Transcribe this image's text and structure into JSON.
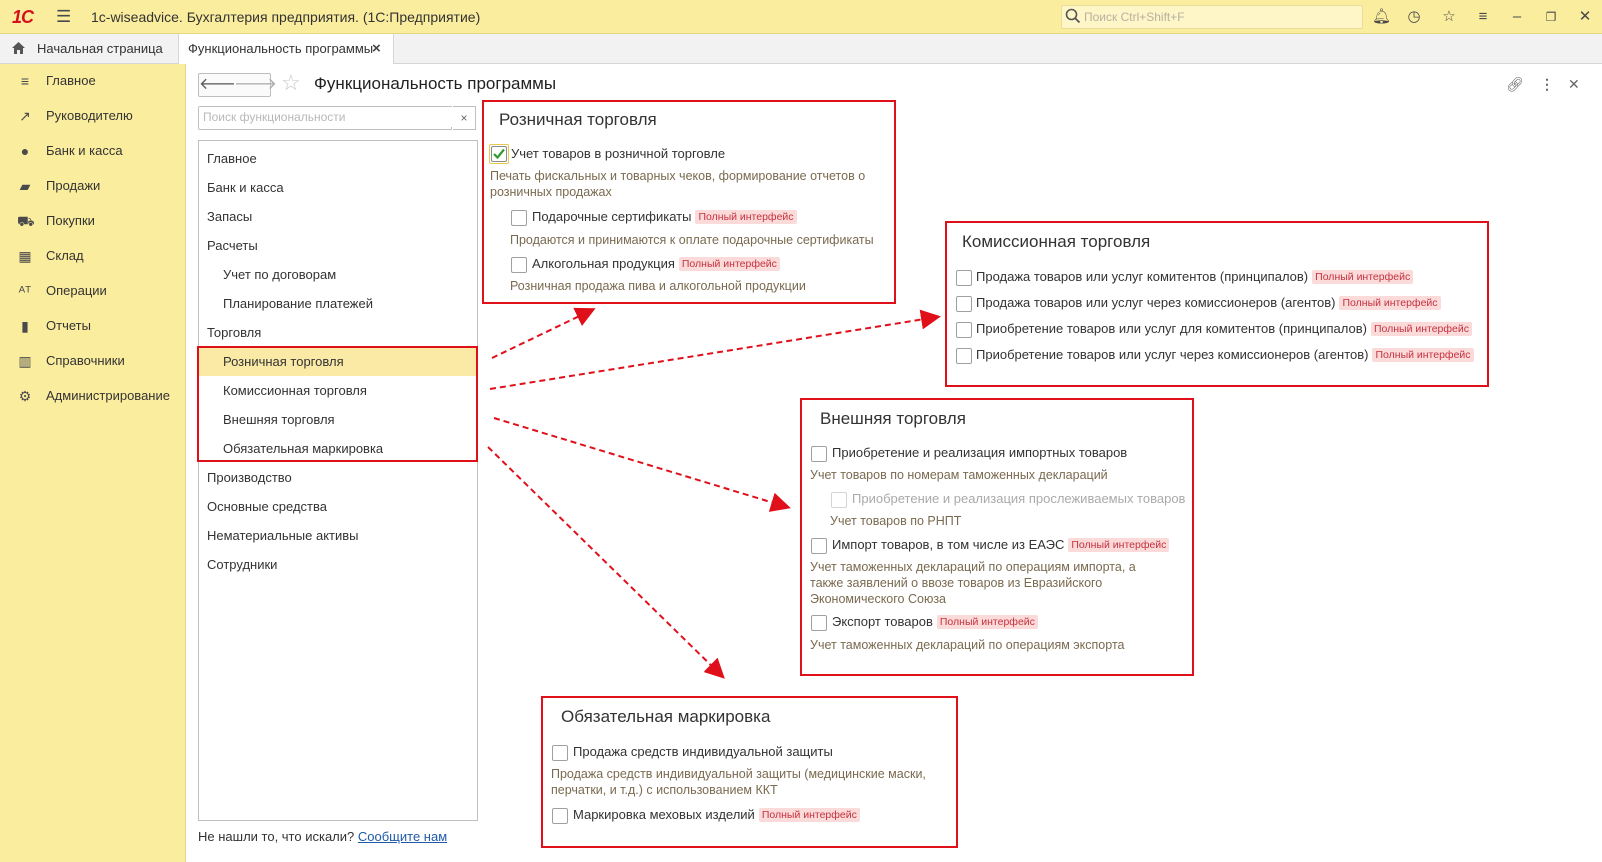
{
  "titlebar": {
    "logo": "1С",
    "title": "1c-wiseadvice. Бухгалтерия предприятия.  (1С:Предприятие)",
    "search_placeholder": "Поиск Ctrl+Shift+F"
  },
  "tabs": {
    "home": "Начальная страница",
    "active": "Функциональность программы",
    "close": "×"
  },
  "sidebar": {
    "items": [
      {
        "label": "Главное",
        "icon": "menu-lines-icon"
      },
      {
        "label": "Руководителю",
        "icon": "trend-icon"
      },
      {
        "label": "Банк и касса",
        "icon": "coin-icon"
      },
      {
        "label": "Продажи",
        "icon": "bag-icon"
      },
      {
        "label": "Покупки",
        "icon": "cart-icon"
      },
      {
        "label": "Склад",
        "icon": "warehouse-icon"
      },
      {
        "label": "Операции",
        "icon": "operations-icon"
      },
      {
        "label": "Отчеты",
        "icon": "bar-chart-icon"
      },
      {
        "label": "Справочники",
        "icon": "book-icon"
      },
      {
        "label": "Администрирование",
        "icon": "gear-icon"
      }
    ]
  },
  "page": {
    "title": "Функциональность программы",
    "func_search_placeholder": "Поиск функциональности",
    "clear": "×",
    "not_found_text": "Не нашли то, что искали?",
    "feedback_link": "Сообщите нам"
  },
  "tree": {
    "items": [
      {
        "label": "Главное",
        "level": 0
      },
      {
        "label": "Банк и касса",
        "level": 0
      },
      {
        "label": "Запасы",
        "level": 0
      },
      {
        "label": "Расчеты",
        "level": 0
      },
      {
        "label": "Учет по договорам",
        "level": 1
      },
      {
        "label": "Планирование платежей",
        "level": 1
      },
      {
        "label": "Торговля",
        "level": 0
      },
      {
        "label": "Розничная торговля",
        "level": 1
      },
      {
        "label": "Комиссионная торговля",
        "level": 1
      },
      {
        "label": "Внешняя торговля",
        "level": 1
      },
      {
        "label": "Обязательная маркировка",
        "level": 1
      },
      {
        "label": "Производство",
        "level": 0
      },
      {
        "label": "Основные средства",
        "level": 0
      },
      {
        "label": "Нематериальные активы",
        "level": 0
      },
      {
        "label": "Сотрудники",
        "level": 0
      }
    ],
    "selected": "Розничная торговля"
  },
  "badge_text": "Полный интерфейс",
  "retail": {
    "title": "Розничная торговля",
    "opt1": "Учет товаров в розничной торговле",
    "opt1_checked": true,
    "opt1_desc": "Печать фискальных и товарных чеков, формирование отчетов о розничных продажах",
    "opt2": "Подарочные сертификаты",
    "opt2_desc": "Продаются и принимаются к оплате подарочные сертификаты",
    "opt3": "Алкогольная продукция",
    "opt3_desc": "Розничная продажа пива и алкогольной продукции"
  },
  "commission": {
    "title": "Комиссионная торговля",
    "opt1": "Продажа товаров или услуг комитентов (принципалов)",
    "opt2": "Продажа товаров или услуг через комиссионеров (агентов)",
    "opt3": "Приобретение товаров или услуг для комитентов (принципалов)",
    "opt4": "Приобретение товаров или услуг через комиссионеров (агентов)"
  },
  "foreign": {
    "title": "Внешняя торговля",
    "opt1": "Приобретение и реализация импортных товаров",
    "opt1_desc": "Учет товаров по номерам таможенных деклараций",
    "opt2": "Приобретение и реализация прослеживаемых товаров",
    "opt2_desc": "Учет товаров по РНПТ",
    "opt3": "Импорт товаров, в том числе из ЕАЭС",
    "opt3_desc": "Учет таможенных деклараций по операциям импорта, а также заявлений о ввозе товаров из Евразийского Экономического Союза",
    "opt4": "Экспорт товаров",
    "opt4_desc": "Учет таможенных деклараций по операциям экспорта"
  },
  "marking": {
    "title": "Обязательная маркировка",
    "opt1": "Продажа средств индивидуальной защиты",
    "opt1_desc": "Продажа средств индивидуальной защиты (медицинские маски, перчатки, и т.д.) с использованием ККТ",
    "opt2": "Маркировка меховых изделий"
  },
  "colors": {
    "accent_yellow": "#fbed9e",
    "annotation_red": "#e0101b",
    "badge_bg": "#fbdada",
    "link_blue": "#1f5aa8"
  }
}
